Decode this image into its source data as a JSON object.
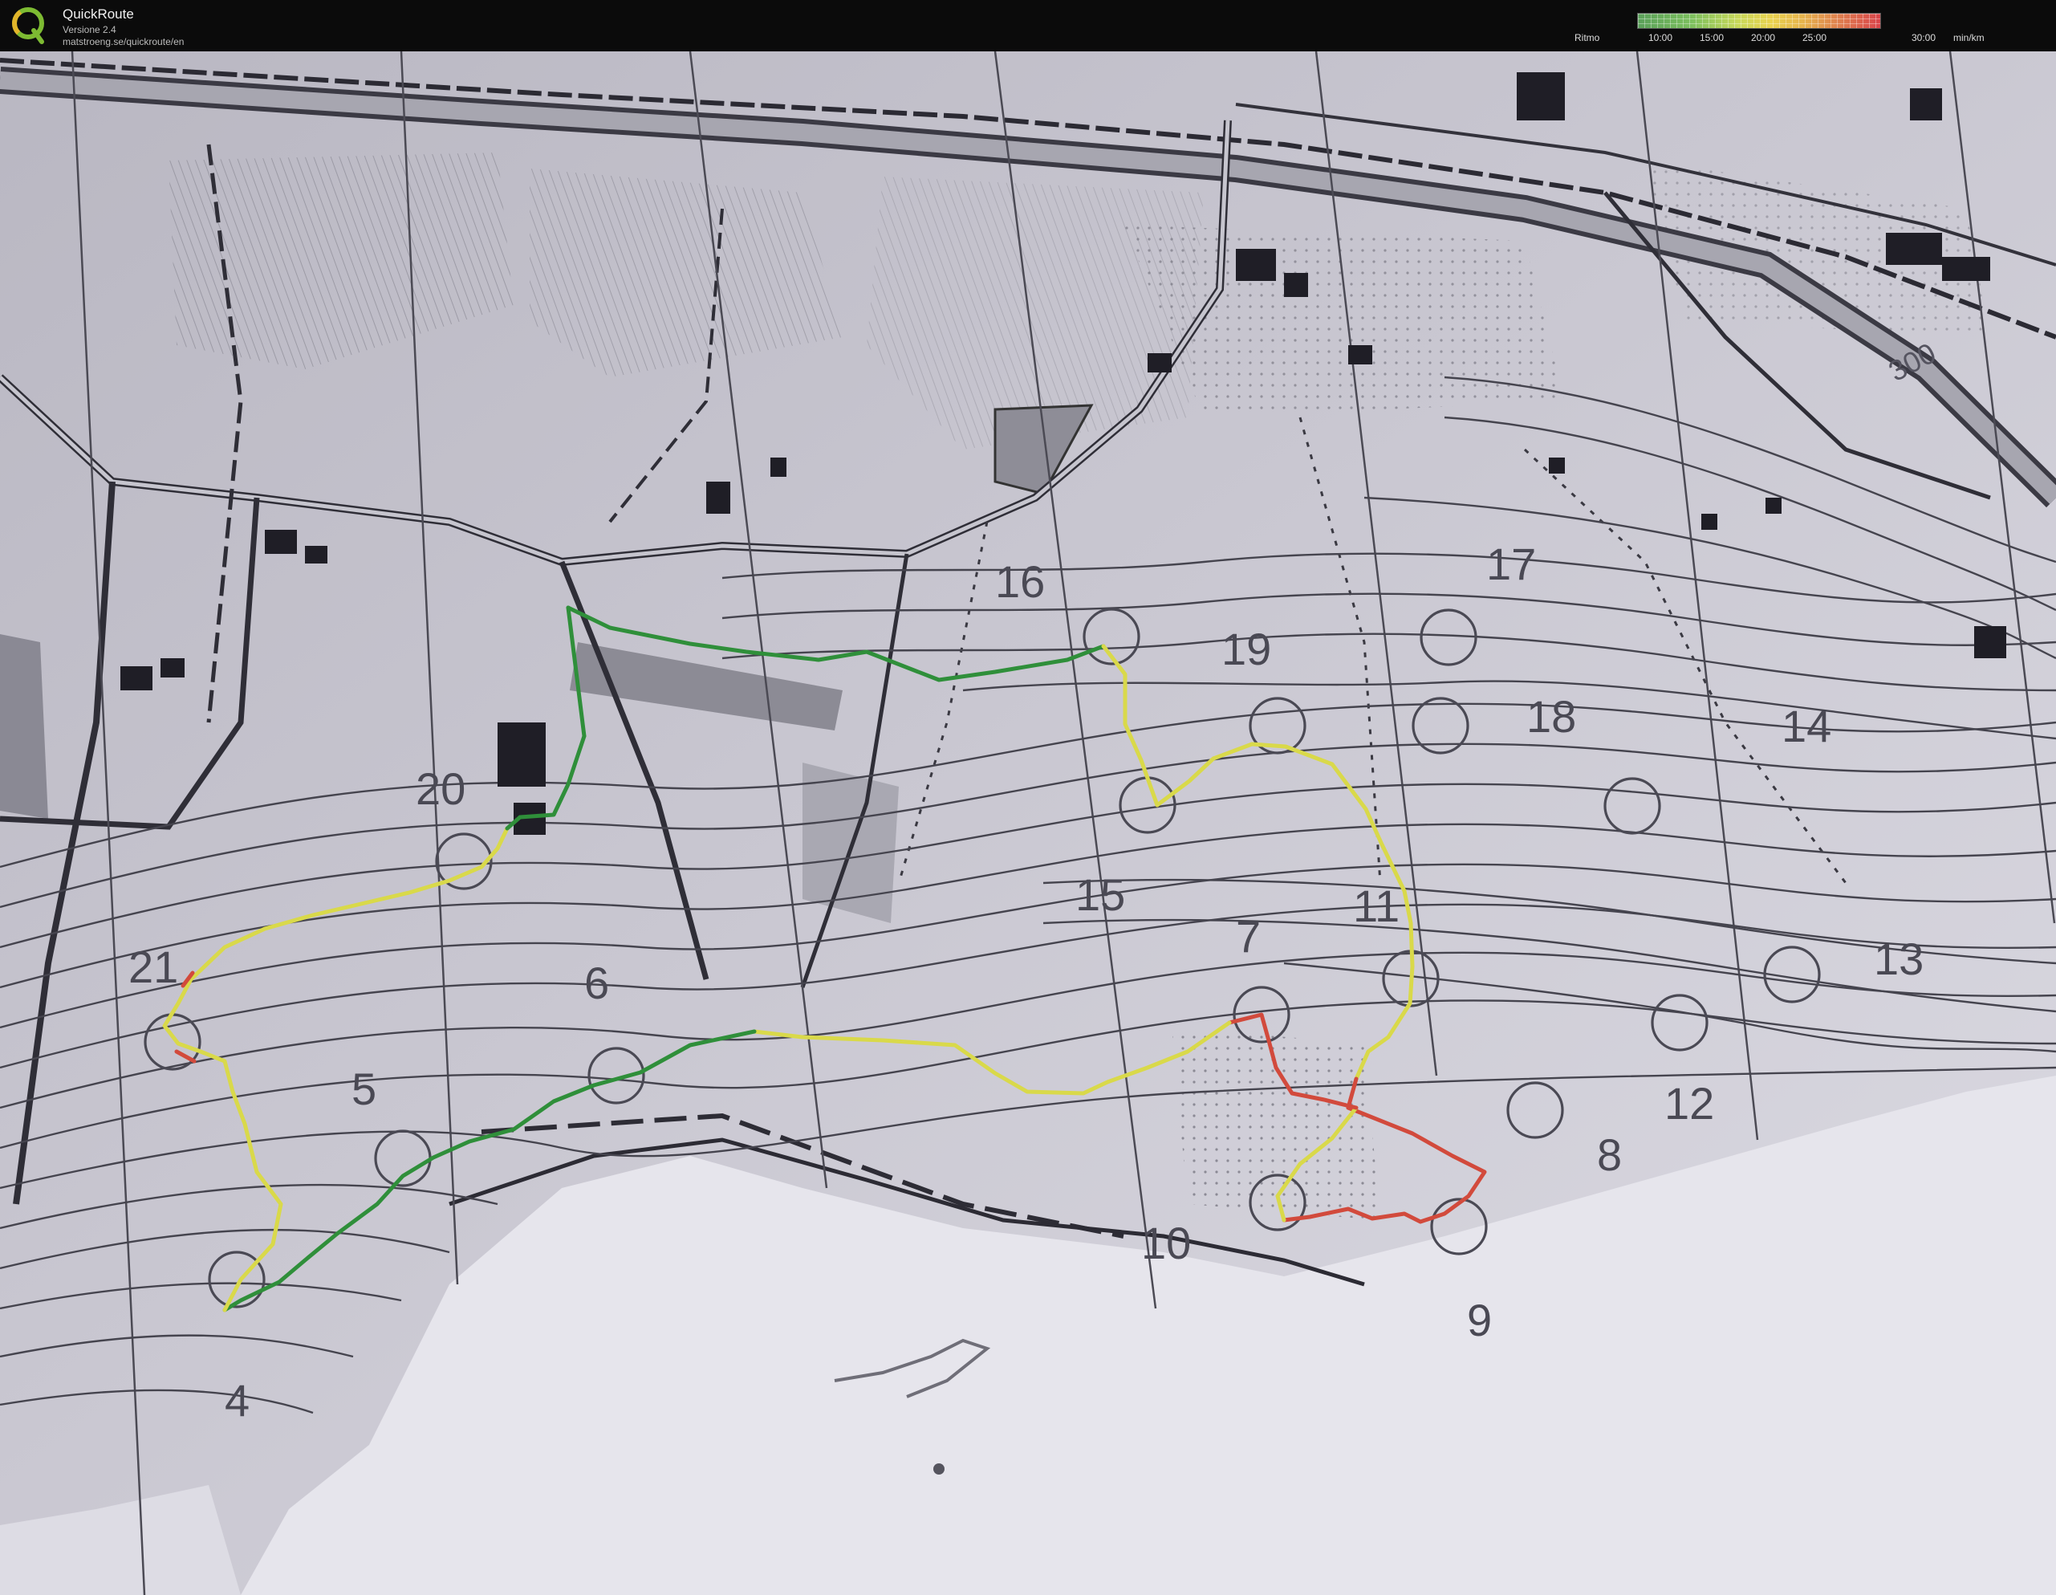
{
  "header": {
    "app_name": "QuickRoute",
    "version": "Versione 2.4",
    "url": "matstroeng.se/quickroute/en"
  },
  "legend": {
    "label": "Ritmo",
    "ticks": [
      "10:00",
      "15:00",
      "20:00",
      "25:00",
      "30:00"
    ],
    "unit": "min/km",
    "colors": [
      "#5aa05a",
      "#cbd95a",
      "#e9d24f",
      "#df7c4f",
      "#d8444a"
    ]
  },
  "map": {
    "control_numbers": [
      "4",
      "5",
      "6",
      "7",
      "8",
      "9",
      "10",
      "11",
      "12",
      "13",
      "14",
      "15",
      "16",
      "17",
      "18",
      "19",
      "20",
      "21"
    ],
    "contour_label": "300",
    "route_colors": {
      "fast": "#2f8f3a",
      "medium": "#d9d94a",
      "slow": "#d24a3c"
    }
  }
}
